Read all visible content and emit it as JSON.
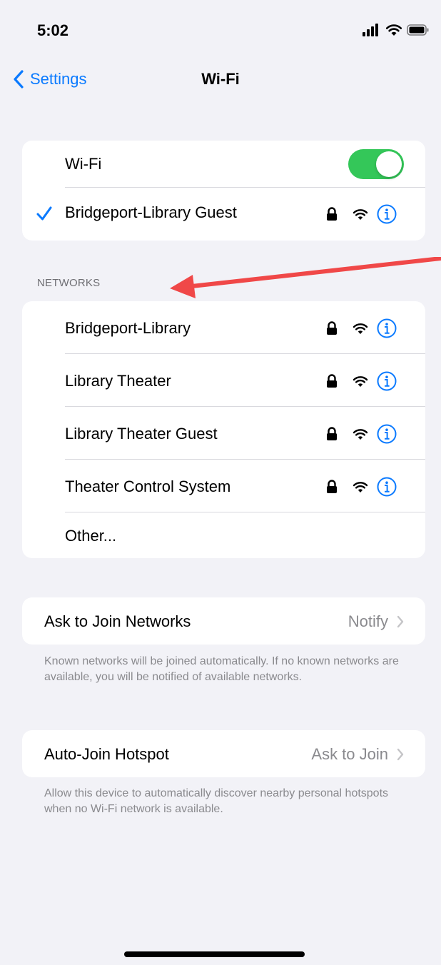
{
  "status_bar": {
    "time": "5:02"
  },
  "nav": {
    "back_label": "Settings",
    "title": "Wi-Fi"
  },
  "wifi_card": {
    "toggle_label": "Wi-Fi",
    "toggle_on": true,
    "connected_network": "Bridgeport-Library Guest"
  },
  "networks": {
    "header": "NETWORKS",
    "items": [
      {
        "name": "Bridgeport-Library",
        "secured": true
      },
      {
        "name": "Library Theater",
        "secured": true
      },
      {
        "name": "Library Theater Guest",
        "secured": true
      },
      {
        "name": "Theater Control System",
        "secured": true
      }
    ],
    "other_label": "Other..."
  },
  "ask_to_join": {
    "label": "Ask to Join Networks",
    "value": "Notify",
    "footer": "Known networks will be joined automatically. If no known networks are available, you will be notified of available networks."
  },
  "auto_join": {
    "label": "Auto-Join Hotspot",
    "value": "Ask to Join",
    "footer": "Allow this device to automatically discover nearby personal hotspots when no Wi-Fi network is available."
  },
  "colors": {
    "accent": "#0a7aff",
    "toggle_on": "#34c759",
    "annotation_arrow": "#f04848",
    "background": "#f2f2f7"
  }
}
